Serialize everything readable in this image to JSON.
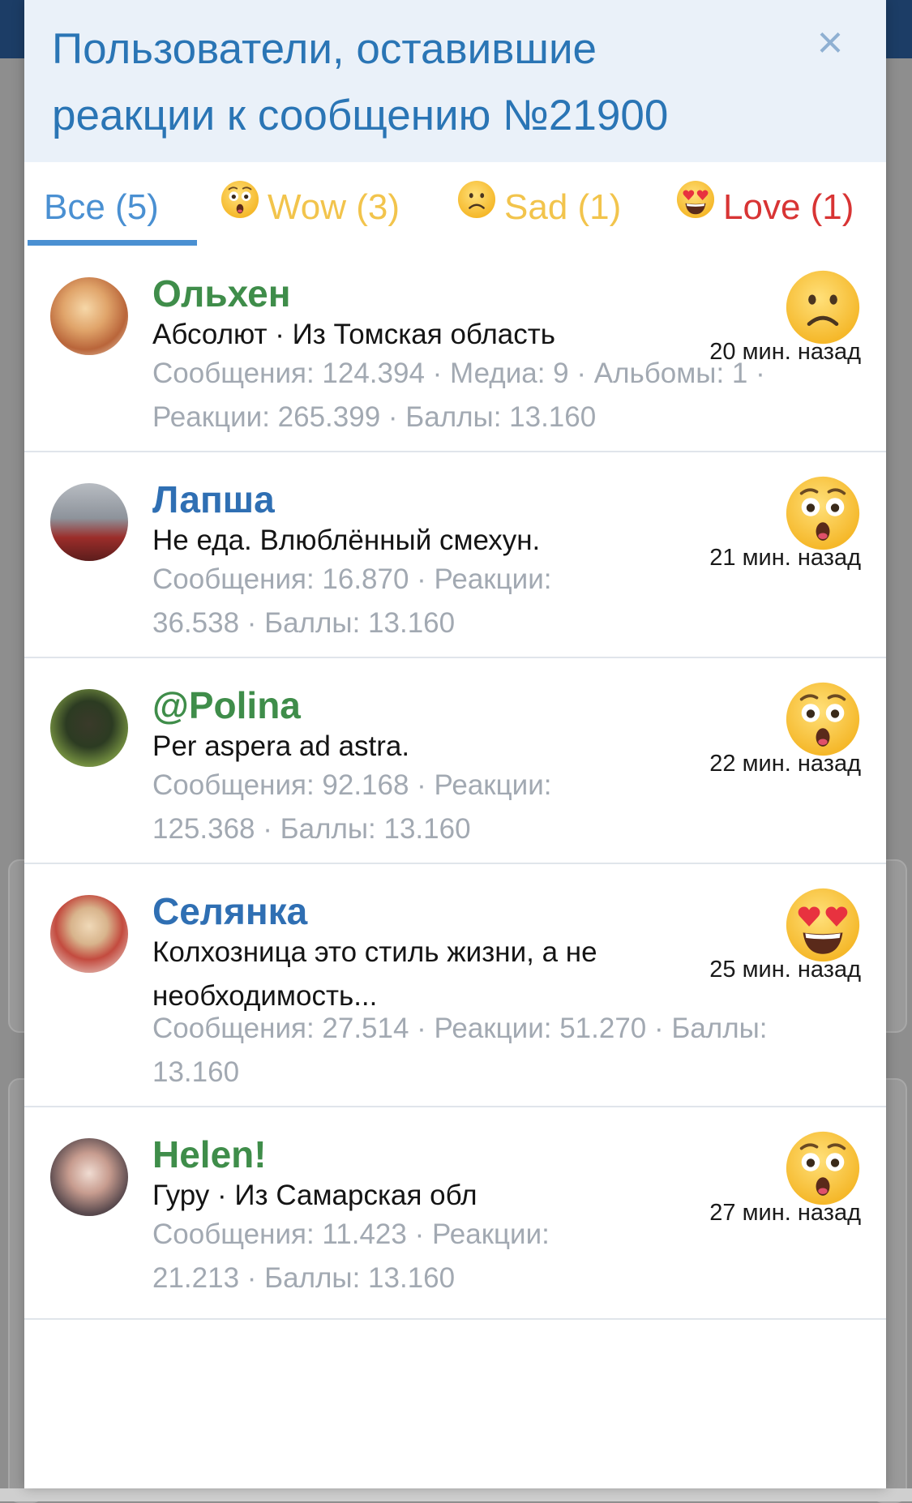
{
  "dialog": {
    "title": "Пользователи, оставившие реакции к сообщению №21900",
    "close_icon": "×"
  },
  "tabs": [
    {
      "label": "Все (5)",
      "color": "#4a90d2",
      "emoji": "",
      "active": true
    },
    {
      "label": "Wow (3)",
      "color": "#f2c44c",
      "emoji": "wow-emoji-icon",
      "active": false
    },
    {
      "label": "Sad (1)",
      "color": "#f2c44c",
      "emoji": "sad-emoji-icon",
      "active": false
    },
    {
      "label": "Love (1)",
      "color": "#d83434",
      "emoji": "love-emoji-icon",
      "active": false
    }
  ],
  "users": [
    {
      "name": "Ольхен",
      "name_color": "#3f8d4a",
      "title": "Абсолют · Из Томская область",
      "stats": "Сообщения: 124.394 · Медиа: 9 · Альбомы: 1 · Реакции: 265.399 · Баллы: 13.160",
      "reaction": "sad",
      "time": "20 мин. назад"
    },
    {
      "name": "Лапша",
      "name_color": "#2f6fb3",
      "title": "Не еда. Влюблённый смехун.",
      "stats": "Сообщения: 16.870 · Реакции: 36.538 · Баллы: 13.160",
      "reaction": "wow",
      "time": "21 мин. назад"
    },
    {
      "name": "@Polina",
      "name_color": "#3f8d4a",
      "title": "Per aspera ad astra.",
      "stats": "Сообщения: 92.168 · Реакции: 125.368 · Баллы: 13.160",
      "reaction": "wow",
      "time": "22 мин. назад"
    },
    {
      "name": "Селянка",
      "name_color": "#2f6fb3",
      "title": "Колхозница это стиль жизни, а не необходимость...",
      "stats": "Сообщения: 27.514 · Реакции: 51.270 · Баллы: 13.160",
      "reaction": "love",
      "time": "25 мин. назад"
    },
    {
      "name": "Helen!",
      "name_color": "#3f8d4a",
      "title": "Гуру · Из Самарская обл",
      "stats": "Сообщения: 11.423 · Реакции: 21.213 · Баллы: 13.160",
      "reaction": "wow",
      "time": "27 мин. назад"
    }
  ]
}
